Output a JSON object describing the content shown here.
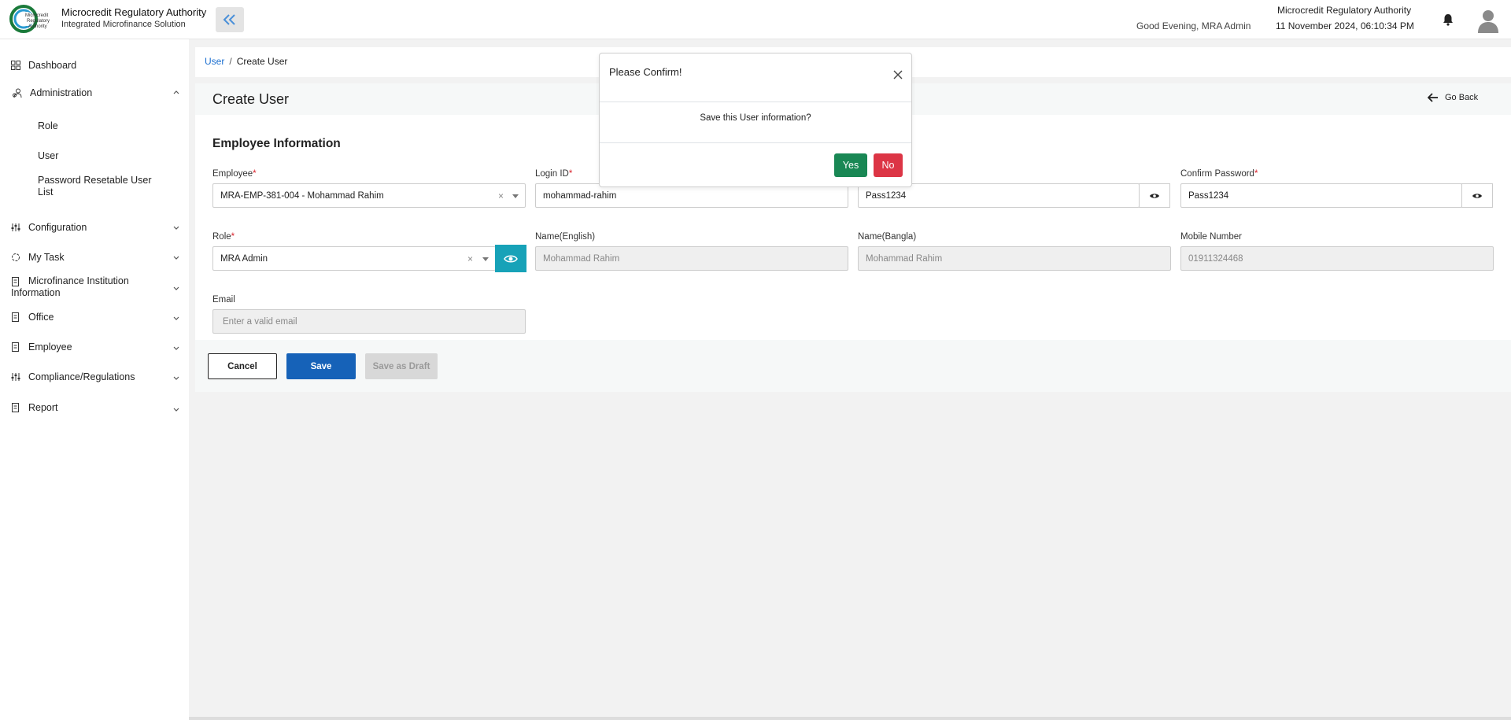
{
  "header": {
    "brand_title": "Microcredit Regulatory Authority",
    "brand_subtitle": "Integrated Microfinance Solution",
    "greeting": "Good Evening, MRA Admin",
    "org_name": "Microcredit Regulatory Authority",
    "datetime": "11 November 2024, 06:10:34 PM"
  },
  "sidebar": {
    "items": [
      {
        "label": "Dashboard",
        "icon": "grid-icon"
      },
      {
        "label": "Administration",
        "icon": "users-cog-icon",
        "expanded": true
      },
      {
        "label": "Configuration",
        "icon": "sliders-icon"
      },
      {
        "label": "My Task",
        "icon": "task-icon"
      },
      {
        "label": "Microfinance Institution Information",
        "icon": "document-icon"
      },
      {
        "label": "Office",
        "icon": "document-icon"
      },
      {
        "label": "Employee",
        "icon": "document-icon"
      },
      {
        "label": "Compliance/Regulations",
        "icon": "sliders-icon"
      },
      {
        "label": "Report",
        "icon": "document-icon"
      }
    ],
    "admin_sub": [
      "Role",
      "User",
      "Password Resetable User List"
    ]
  },
  "breadcrumb": {
    "link": "User",
    "sep": "/",
    "current": "Create User"
  },
  "page": {
    "title": "Create User",
    "go_back": "Go Back",
    "section_title": "Employee Information"
  },
  "form": {
    "employee_label": "Employee",
    "employee_value": "MRA-EMP-381-004 - Mohammad Rahim",
    "login_label": "Login ID",
    "login_value": "mohammad-rahim",
    "password_value": "Pass1234",
    "confirm_label": "Confirm Password",
    "confirm_value": "Pass1234",
    "role_label": "Role",
    "role_value": "MRA Admin",
    "name_en_label": "Name(English)",
    "name_en_value": "Mohammad Rahim",
    "name_bn_label": "Name(Bangla)",
    "name_bn_value": "Mohammad Rahim",
    "mobile_label": "Mobile Number",
    "mobile_value": "01911324468",
    "email_label": "Email",
    "email_placeholder": "Enter a valid email",
    "required_mark": "*"
  },
  "buttons": {
    "cancel": "Cancel",
    "save": "Save",
    "draft": "Save as Draft"
  },
  "modal": {
    "title": "Please Confirm!",
    "body": "Save this User information?",
    "yes": "Yes",
    "no": "No"
  },
  "colors": {
    "primary": "#1662b8",
    "teal": "#17a2b8",
    "success": "#198754",
    "danger": "#dc3545",
    "link": "#1b6fd0"
  }
}
